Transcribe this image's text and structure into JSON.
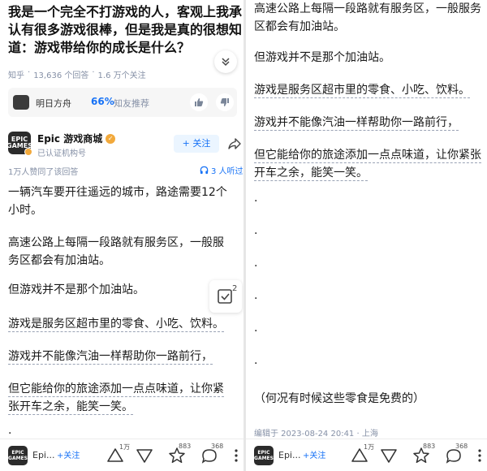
{
  "question": {
    "title": "我是一个完全不打游戏的人，客观上我承认有很多游戏很棒，但是我是真的很想知道：游戏带给你的成长是什么？",
    "source": "知乎",
    "answers": "13,636 个回答",
    "follows": "1.6 万个关注"
  },
  "sponsor": {
    "name": "明日方舟",
    "percent": "66%",
    "recommend": "知友推荐"
  },
  "author": {
    "avatar_text": "EPIC GAMES",
    "name": "Epic 游戏商城",
    "verified": "已认证机构号",
    "follow_label": "+ 关注"
  },
  "answer_meta": {
    "upvote_note": "1万人赞同了该回答",
    "listeners": "3 人听过"
  },
  "answer_left": [
    "一辆汽车要开往遥远的城市，路途需要12个小时。",
    "高速公路上每隔一段路就有服务区，一般服务区都会有加油站。",
    "但游戏并不是那个加油站。",
    "游戏是服务区超市里的零食、小吃、饮料。",
    "游戏并不能像汽油一样帮助你一路前行，",
    "但它能给你的旅途添加一点点味道，让你紧张开车之余，能笑一笑。"
  ],
  "float_badge": "2",
  "answer_right": [
    "高速公路上每隔一段路就有服务区，一般服务区都会有加油站。",
    "但游戏并不是那个加油站。",
    "游戏是服务区超市里的零食、小吃、饮料。",
    "游戏并不能像汽油一样帮助你一路前行，",
    "但它能给你的旅途添加一点点味道，让你紧张开车之余，能笑一笑。"
  ],
  "dots": ".",
  "closing_line": "（何况有时候这些零食是免费的）",
  "edit_info": "编辑于 2023-08-24 20:41 · 上海",
  "bottom_bar": {
    "name": "Epi...",
    "follow": "+关注",
    "upvotes": "1万",
    "likes": "883",
    "comments": "368"
  }
}
